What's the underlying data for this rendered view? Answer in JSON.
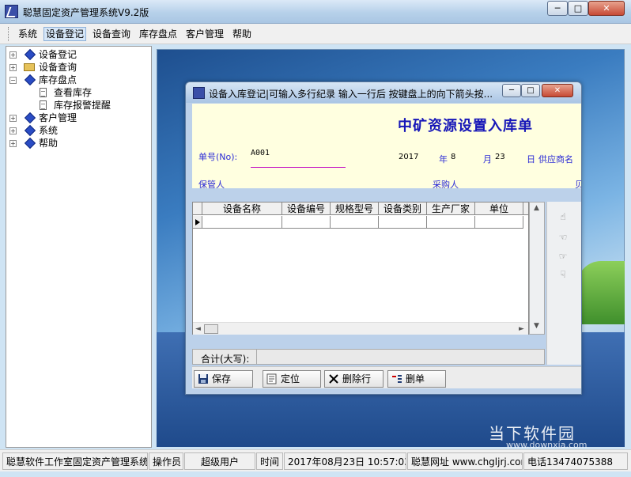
{
  "window": {
    "title": "聪慧固定资产管理系统V9.2版",
    "controls": {
      "minimize": "─",
      "maximize": "□",
      "close": "✕"
    }
  },
  "menu": {
    "items": [
      "系统",
      "设备登记",
      "设备查询",
      "库存盘点",
      "客户管理",
      "帮助"
    ],
    "active_index": 1
  },
  "tree": {
    "nodes": [
      {
        "label": "设备登记",
        "expander": "+",
        "icon": "diamond-icon"
      },
      {
        "label": "设备查询",
        "expander": "+",
        "icon": "folder-icon"
      },
      {
        "label": "库存盘点",
        "expander": "-",
        "icon": "diamond-icon"
      },
      {
        "label": "查看库存",
        "icon": "document-icon"
      },
      {
        "label": "库存报警提醒",
        "icon": "document-icon"
      },
      {
        "label": "客户管理",
        "expander": "+",
        "icon": "diamond-icon"
      },
      {
        "label": "系统",
        "expander": "+",
        "icon": "diamond-icon"
      },
      {
        "label": "帮助",
        "expander": "+",
        "icon": "diamond-icon"
      }
    ]
  },
  "dialog": {
    "title": "设备入库登记|可输入多行纪录 输入一行后 按键盘上的向下箭头按...",
    "form_title": "中矿资源设置入库单",
    "order_no_label": "单号(No):",
    "order_no_value": "A001",
    "year_value": "2017",
    "year_label": "年",
    "month_value": "8",
    "month_label": "月",
    "day_value": "23",
    "day_label": "日",
    "supplier_label": "供应商名",
    "keeper_label": "保管人",
    "buyer_label": "采购人",
    "clipped_label": "贝",
    "grid_headers": [
      "设备名称",
      "设备编号",
      "规格型号",
      "设备类别",
      "生产厂家",
      "单位"
    ],
    "total_label": "合计(大写):",
    "buttons": {
      "save": "保存",
      "locate": "定位",
      "delete_row": "删除行",
      "delete_order": "删单"
    },
    "side_icons": [
      "hand-up-icon",
      "hand-left-icon",
      "hand-right-icon",
      "hand-down-icon"
    ]
  },
  "status": {
    "company": "聪慧软件工作室固定资产管理系统",
    "operator_label": "操作员",
    "operator_value": "超级用户",
    "time_label": "时间",
    "time_value": "2017年08月23日 10:57:03",
    "website": "聪慧网址 www.chgljrj.com",
    "phone": "电话13474075388"
  },
  "watermark": {
    "text": "当下软件园",
    "url": "www.downxia.com"
  },
  "colors": {
    "form_bg": "#ffffe0",
    "form_label": "#2b2bd6",
    "form_title": "#1717b8",
    "underline": "#c000c0"
  }
}
